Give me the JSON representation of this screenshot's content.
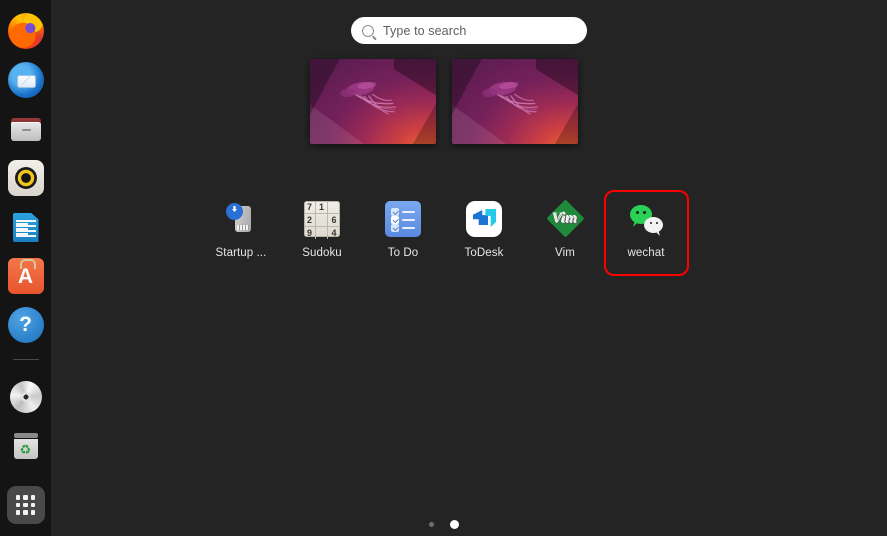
{
  "desktop": {
    "background_color": "#242424",
    "environment": "GNOME Activities Overview"
  },
  "dock": {
    "background_color": "#141414",
    "items": [
      {
        "name": "firefox",
        "label": "Firefox Web Browser",
        "icon": "firefox-icon"
      },
      {
        "name": "thunderbird",
        "label": "Thunderbird Mail",
        "icon": "thunderbird-icon"
      },
      {
        "name": "files",
        "label": "Files",
        "icon": "files-icon"
      },
      {
        "name": "rhythmbox",
        "label": "Rhythmbox",
        "icon": "rhythmbox-icon"
      },
      {
        "name": "writer",
        "label": "LibreOffice Writer",
        "icon": "libreoffice-writer-icon"
      },
      {
        "name": "software",
        "label": "Ubuntu Software",
        "icon": "ubuntu-software-icon"
      },
      {
        "name": "help",
        "label": "Help",
        "icon": "help-icon"
      },
      {
        "name": "disc",
        "label": "CD/DVD Drive",
        "icon": "optical-disc-icon"
      },
      {
        "name": "trash",
        "label": "Trash",
        "icon": "trash-icon"
      }
    ],
    "app_grid": {
      "label": "Show Applications",
      "icon": "app-grid-icon"
    }
  },
  "search": {
    "placeholder": "Type to search",
    "value": "",
    "icon": "search-icon"
  },
  "workspaces": {
    "count": 2,
    "active_index": 1,
    "items": [
      {
        "name": "workspace-1",
        "label": "Workspace 1"
      },
      {
        "name": "workspace-2",
        "label": "Workspace 2"
      }
    ]
  },
  "apps": {
    "selected": "wechat",
    "selection_color": "#ff0000",
    "items": [
      {
        "name": "startup-disk-creator",
        "label": "Startup ...",
        "icon": "usb-startup-disk-icon",
        "selected": false
      },
      {
        "name": "sudoku",
        "label": "Sudoku",
        "icon": "sudoku-grid-icon",
        "selected": false
      },
      {
        "name": "to-do",
        "label": "To Do",
        "icon": "checklist-icon",
        "selected": false
      },
      {
        "name": "todesk",
        "label": "ToDesk",
        "icon": "todesk-icon",
        "selected": false
      },
      {
        "name": "vim",
        "label": "Vim",
        "icon": "vim-icon",
        "selected": false
      },
      {
        "name": "wechat",
        "label": "wechat",
        "icon": "wechat-icon",
        "selected": true
      }
    ]
  },
  "sudoku_grid": [
    "7",
    "1",
    "",
    "2",
    "",
    "6",
    "9",
    "",
    "4"
  ],
  "pages": {
    "count": 2,
    "active_index": 1
  }
}
